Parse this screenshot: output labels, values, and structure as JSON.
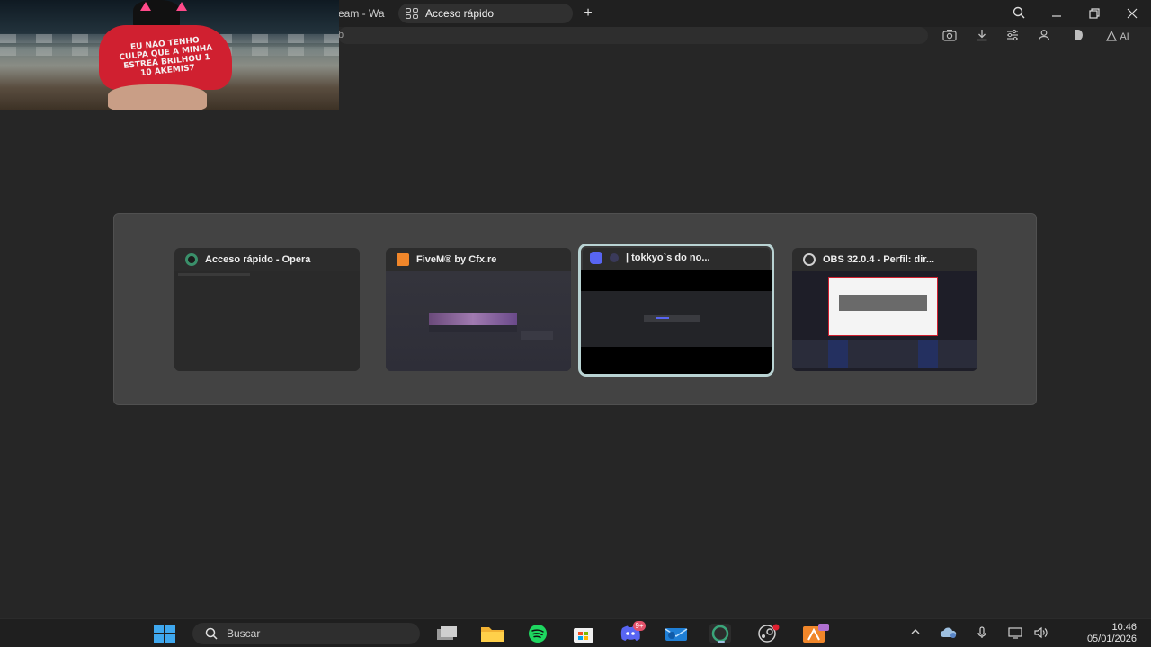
{
  "browser": {
    "prev_tab_label": "eam - Wa",
    "active_tab_label": "Acceso rápido",
    "new_tab_symbol": "+",
    "address_text": "b",
    "icons": {
      "tab": "speed-dial-grid-icon",
      "search": "search-icon",
      "minimize": "minimize-icon",
      "restore": "restore-icon",
      "close": "close-icon",
      "snapshot": "camera-icon",
      "downloads": "download-icon",
      "easy_setup": "settings-sliders-icon",
      "account": "account-icon",
      "battery": "battery-saver-icon",
      "ai": "aria-ai-icon"
    },
    "ai_label": "AI"
  },
  "webcam": {
    "shirt_text": "EU NÃO TENHO CULPA QUE A MINHA ESTREA BRILHOU 1 10 AKEMIS7"
  },
  "switcher": {
    "windows": [
      {
        "title": "Acceso rápido - Opera",
        "icon": "opera-gx-icon",
        "icon_color": "#3a8f6a",
        "selected": false
      },
      {
        "title": "FiveM® by Cfx.re",
        "icon": "fivem-icon",
        "icon_color": "#f0862a",
        "selected": false
      },
      {
        "title": "| tokkyo`s do no...",
        "icon": "discord-icon",
        "icon_color": "#5865f2",
        "selected": true
      },
      {
        "title": "OBS 32.0.4 - Perfil: dir...",
        "icon": "obs-icon",
        "icon_color": "#d0d0d0",
        "selected": false
      }
    ]
  },
  "taskbar": {
    "search_placeholder": "Buscar",
    "discord_badge": "9+",
    "clock_time": "10:46",
    "clock_date": "05/01/2026",
    "apps": [
      "windows-start-icon",
      "task-view-icon",
      "file-explorer-icon",
      "spotify-icon",
      "microsoft-store-icon",
      "discord-icon",
      "mail-icon",
      "opera-gx-icon",
      "steam-icon",
      "fivem-icon"
    ],
    "tray": [
      "chevron-up-icon",
      "onedrive-icon",
      "microphone-icon",
      "network-icon",
      "volume-icon"
    ]
  }
}
